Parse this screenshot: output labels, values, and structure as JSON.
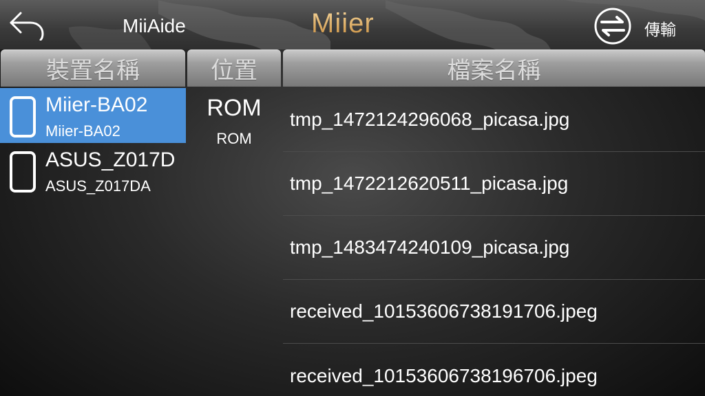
{
  "header": {
    "app_title": "MiiAide",
    "logo": "Miier",
    "transfer_label": "傳輸",
    "back_icon": "back-arrow-icon",
    "transfer_icon": "transfer-arrows-icon"
  },
  "columns": {
    "device_name": "裝置名稱",
    "location": "位置",
    "file_name": "檔案名稱"
  },
  "devices": [
    {
      "name": "Miier-BA02",
      "sub": "Miier-BA02",
      "selected": true
    },
    {
      "name": "ASUS_Z017D",
      "sub": "ASUS_Z017DA",
      "selected": false
    }
  ],
  "location": {
    "main": "ROM",
    "sub": "ROM"
  },
  "files": [
    "tmp_1472124296068_picasa.jpg",
    "tmp_1472212620511_picasa.jpg",
    "tmp_1483474240109_picasa.jpg",
    "received_10153606738191706.jpeg",
    "received_10153606738196706.jpeg"
  ],
  "colors": {
    "selected": "#4a90d9",
    "logo_gold": "#e2b26a"
  }
}
